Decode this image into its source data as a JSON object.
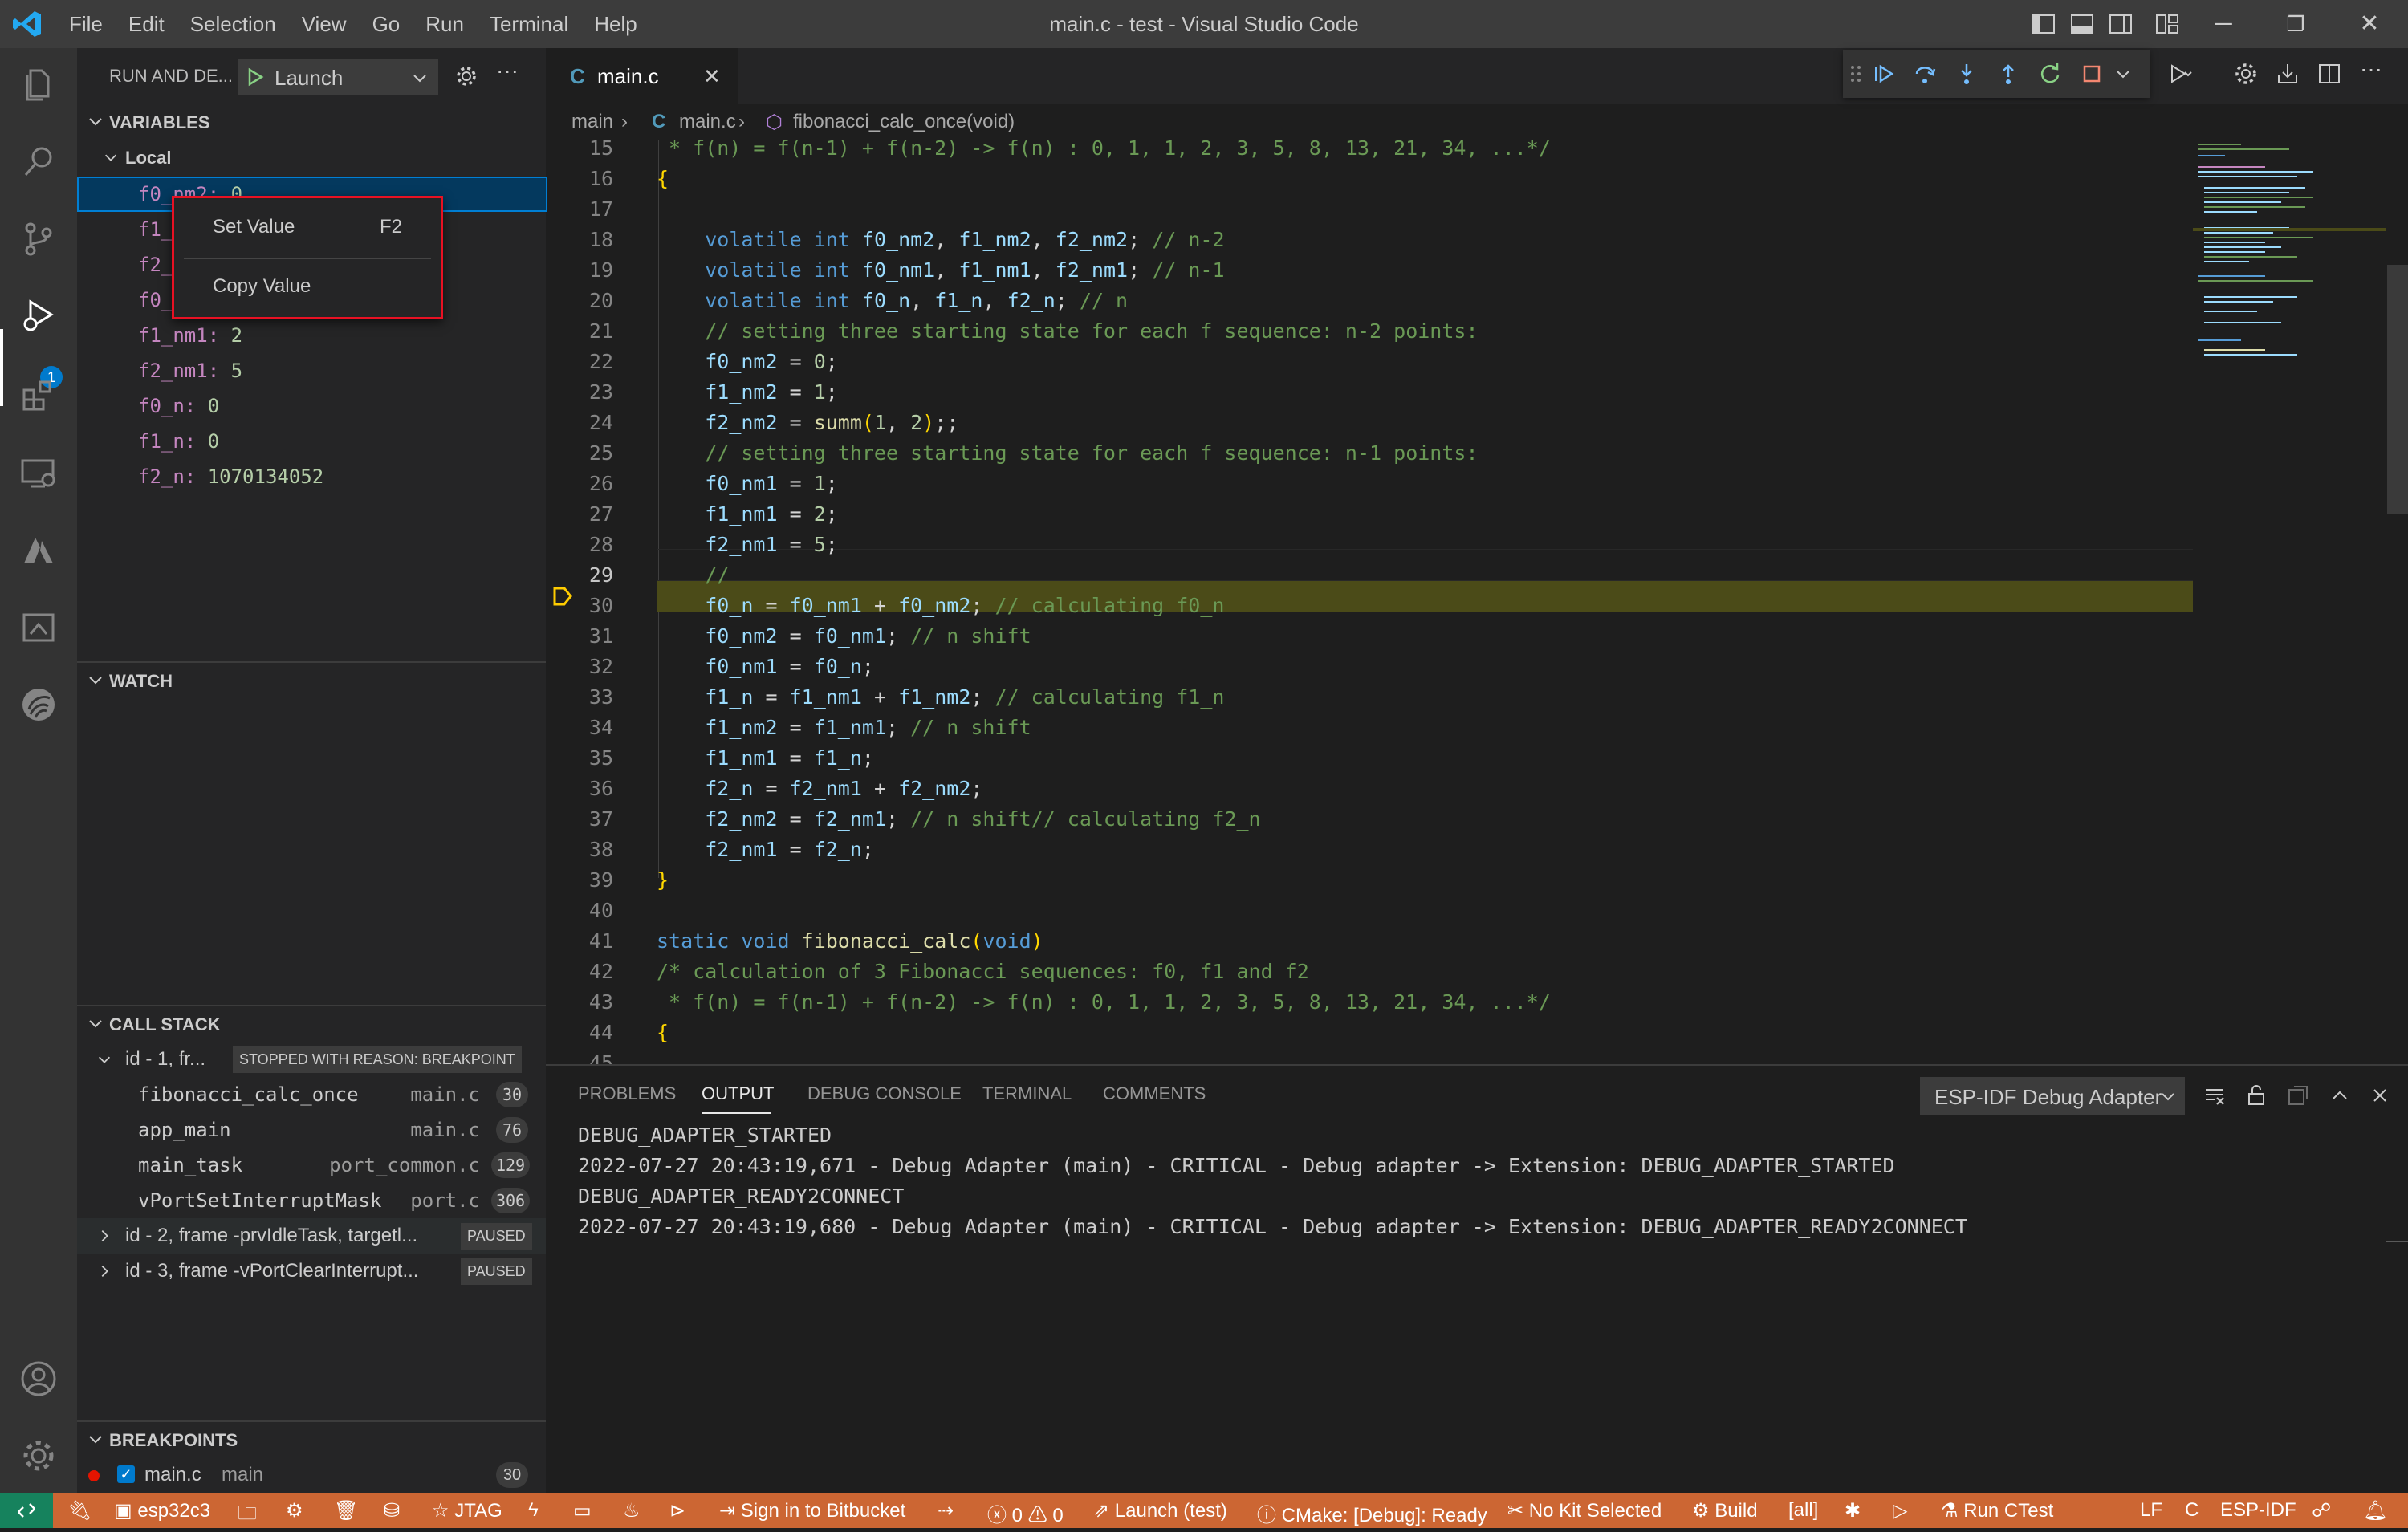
{
  "window": {
    "title": "main.c - test - Visual Studio Code",
    "menu": [
      "File",
      "Edit",
      "Selection",
      "View",
      "Go",
      "Run",
      "Terminal",
      "Help"
    ]
  },
  "activity_bar": {
    "debug_badge": "1",
    "items": [
      "explorer-icon",
      "search-icon",
      "source-control-icon",
      "run-debug-icon",
      "extensions-icon",
      "remote-explorer-icon",
      "azure-icon",
      "espressif-explorer-icon",
      "espressif-icon",
      "account-icon",
      "settings-gear-icon"
    ]
  },
  "sidebar": {
    "title": "RUN AND DE...",
    "launch_config": "Launch",
    "variables": {
      "header": "VARIABLES",
      "scope": "Local",
      "items": [
        {
          "name": "f0_nm2:",
          "value": "0"
        },
        {
          "name": "f1_",
          "value": ""
        },
        {
          "name": "f2_",
          "value": ""
        },
        {
          "name": "f0_",
          "value": ""
        },
        {
          "name": "f1_nm1:",
          "value": "2"
        },
        {
          "name": "f2_nm1:",
          "value": "5"
        },
        {
          "name": "f0_n:",
          "value": "0"
        },
        {
          "name": "f1_n:",
          "value": "0"
        },
        {
          "name": "f2_n:",
          "value": "1070134052"
        }
      ]
    },
    "watch": {
      "header": "WATCH"
    },
    "call_stack": {
      "header": "CALL STACK",
      "threads": [
        {
          "label": "id - 1, fr...",
          "status": "STOPPED WITH REASON: BREAKPOINT"
        },
        {
          "label": "id - 2, frame -prvIdleTask, targetl...",
          "status": "PAUSED"
        },
        {
          "label": "id - 3, frame -vPortClearInterrupt...",
          "status": "PAUSED"
        }
      ],
      "frames": [
        {
          "func": "fibonacci_calc_once",
          "file": "main.c",
          "line": "30"
        },
        {
          "func": "app_main",
          "file": "main.c",
          "line": "76"
        },
        {
          "func": "main_task",
          "file": "port_common.c",
          "line": "129"
        },
        {
          "func": "vPortSetInterruptMask",
          "file": "port.c",
          "line": "306"
        }
      ]
    },
    "breakpoints": {
      "header": "BREAKPOINTS",
      "items": [
        {
          "file": "main.c",
          "folder": "main",
          "line": "30"
        }
      ]
    }
  },
  "context_menu": {
    "items": [
      {
        "label": "Set Value",
        "shortcut": "F2"
      },
      {
        "label": "Copy Value",
        "shortcut": ""
      }
    ]
  },
  "editor": {
    "tab": {
      "icon": "C",
      "label": "main.c"
    },
    "breadcrumb": {
      "folder": "main",
      "file_icon": "C",
      "file": "main.c",
      "symbol": "fibonacci_calc_once(void)"
    },
    "line_numbers": [
      "15",
      "16",
      "17",
      "18",
      "19",
      "20",
      "21",
      "22",
      "23",
      "24",
      "25",
      "26",
      "27",
      "28",
      "29",
      "30",
      "31",
      "32",
      "33",
      "34",
      "35",
      "36",
      "37",
      "38",
      "39",
      "40",
      "41",
      "42",
      "43",
      "44",
      "45"
    ],
    "current_line": "30"
  },
  "panel": {
    "tabs": [
      "PROBLEMS",
      "OUTPUT",
      "DEBUG CONSOLE",
      "TERMINAL",
      "COMMENTS"
    ],
    "active_tab": "OUTPUT",
    "output_channel": "ESP-IDF Debug Adapter",
    "lines": [
      "DEBUG_ADAPTER_STARTED",
      "2022-07-27 20:43:19,671 - Debug Adapter (main) - CRITICAL - Debug adapter -> Extension: DEBUG_ADAPTER_STARTED",
      "DEBUG_ADAPTER_READY2CONNECT",
      "2022-07-27 20:43:19,680 - Debug Adapter (main) - CRITICAL - Debug adapter -> Extension: DEBUG_ADAPTER_READY2CONNECT"
    ]
  },
  "status_bar": {
    "target": "esp32c3",
    "jtag": "JTAG",
    "bitbucket": "Sign in to Bitbucket",
    "errors": "0",
    "warnings": "0",
    "launch": "Launch (test)",
    "cmake": "CMake: [Debug]: Ready",
    "kit": "No Kit Selected",
    "build": "Build",
    "target_all": "[all]",
    "ctest": "Run CTest",
    "eol": "LF",
    "language": "C",
    "idf": "ESP-IDF",
    "colors": {
      "background": "#cc6633",
      "remote": "#16825d"
    }
  }
}
